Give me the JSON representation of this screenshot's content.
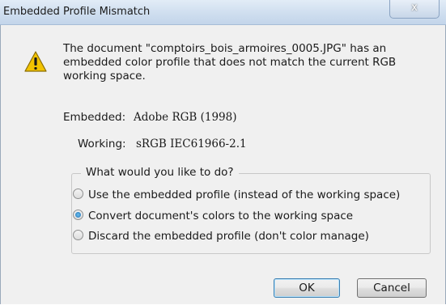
{
  "window": {
    "title": "Embedded Profile Mismatch",
    "close_label": "x"
  },
  "message": "The document \"comptoirs_bois_armoires_0005.JPG\" has an embedded color profile that does not match the current RGB working space.",
  "embedded": {
    "label": "Embedded:",
    "value": "Adobe RGB (1998)"
  },
  "working": {
    "label": "Working:",
    "value": "sRGB IEC61966-2.1"
  },
  "options": {
    "legend": "What would you like to do?",
    "items": [
      {
        "label": "Use the embedded profile (instead of the working space)",
        "selected": false
      },
      {
        "label": "Convert document's colors to the working space",
        "selected": true
      },
      {
        "label": "Discard the embedded profile (don't color manage)",
        "selected": false
      }
    ]
  },
  "buttons": {
    "ok": "OK",
    "cancel": "Cancel"
  },
  "icons": {
    "warning": "warning-icon"
  },
  "colors": {
    "warning_fill": "#f2c300",
    "accent": "#2f7fc3"
  }
}
